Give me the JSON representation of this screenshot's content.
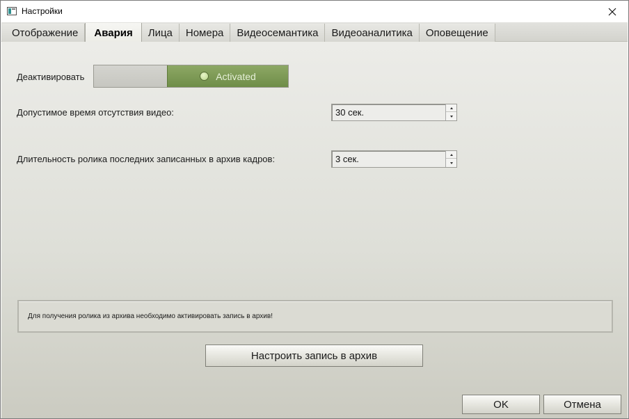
{
  "window": {
    "title": "Настройки",
    "close_symbol": "×"
  },
  "tabs": [
    {
      "label": "Отображение",
      "active": false
    },
    {
      "label": "Авария",
      "active": true
    },
    {
      "label": "Лица",
      "active": false
    },
    {
      "label": "Номера",
      "active": false
    },
    {
      "label": "Видеосемантика",
      "active": false
    },
    {
      "label": "Видеоаналитика",
      "active": false
    },
    {
      "label": "Оповещение",
      "active": false
    }
  ],
  "form": {
    "deactivate_label": "Деактивировать",
    "toggle_state_label": "Activated",
    "video_absence_label": "Допустимое время отсутствия видео:",
    "video_absence_value": "30 сек.",
    "clip_duration_label": "Длительность ролика последних записанных в архив кадров:",
    "clip_duration_value": "3 сек."
  },
  "notice": {
    "text": "Для получения ролика из архива необходимо активировать запись в архив!"
  },
  "buttons": {
    "configure_archive": "Настроить запись в архив",
    "ok": "OK",
    "cancel": "Отмена"
  },
  "colors": {
    "toggle_active": "#7b9a53",
    "content_bg": "#dedfd8"
  },
  "icons": {
    "app": "settings-window-icon",
    "close": "close-icon",
    "status": "status-led-icon"
  }
}
